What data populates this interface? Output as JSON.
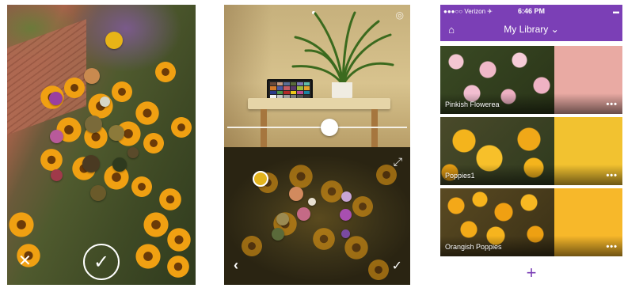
{
  "capture_screen": {
    "close_glyph": "✕",
    "capture_glyph": "✓",
    "picked_colors": [
      "#e8b417",
      "#c98a4f",
      "#9a3fa0",
      "#d6d6c8",
      "#7a6a3a",
      "#8c7a3a",
      "#b85a9a",
      "#4a3a22",
      "#2e3a1e",
      "#5a4a2a",
      "#a03a4a",
      "#6a5a2a"
    ]
  },
  "plant_screen": {
    "page_indicator_glyph": "•",
    "settings_glyph": "◎",
    "expand_glyph": "⤢",
    "back_glyph": "‹",
    "done_glyph": "✓",
    "slider_value": 0.57,
    "picked_colors": [
      "#e3b41e",
      "#d28a5e",
      "#e8e0d0",
      "#c9a6d6",
      "#a84fb0",
      "#9b8a52",
      "#7a4aa0",
      "#c46a86",
      "#5a6a3a"
    ]
  },
  "library_screen": {
    "status": {
      "carrier": "●●●○○ Verizon ✈",
      "time": "6:46 PM",
      "battery": "▬"
    },
    "logo_glyph": "⌂",
    "title": "My Library ⌄",
    "items": [
      {
        "name": "Pinkish Flowerea",
        "more": "•••",
        "color": "#e9aaa3"
      },
      {
        "name": "Poppies1",
        "more": "•••",
        "color": "#f2c230"
      },
      {
        "name": "Orangish Poppies",
        "more": "•••",
        "color": "#f7b82a"
      }
    ],
    "add_glyph": "+"
  },
  "colors": {
    "accent": "#7b3fb6"
  }
}
